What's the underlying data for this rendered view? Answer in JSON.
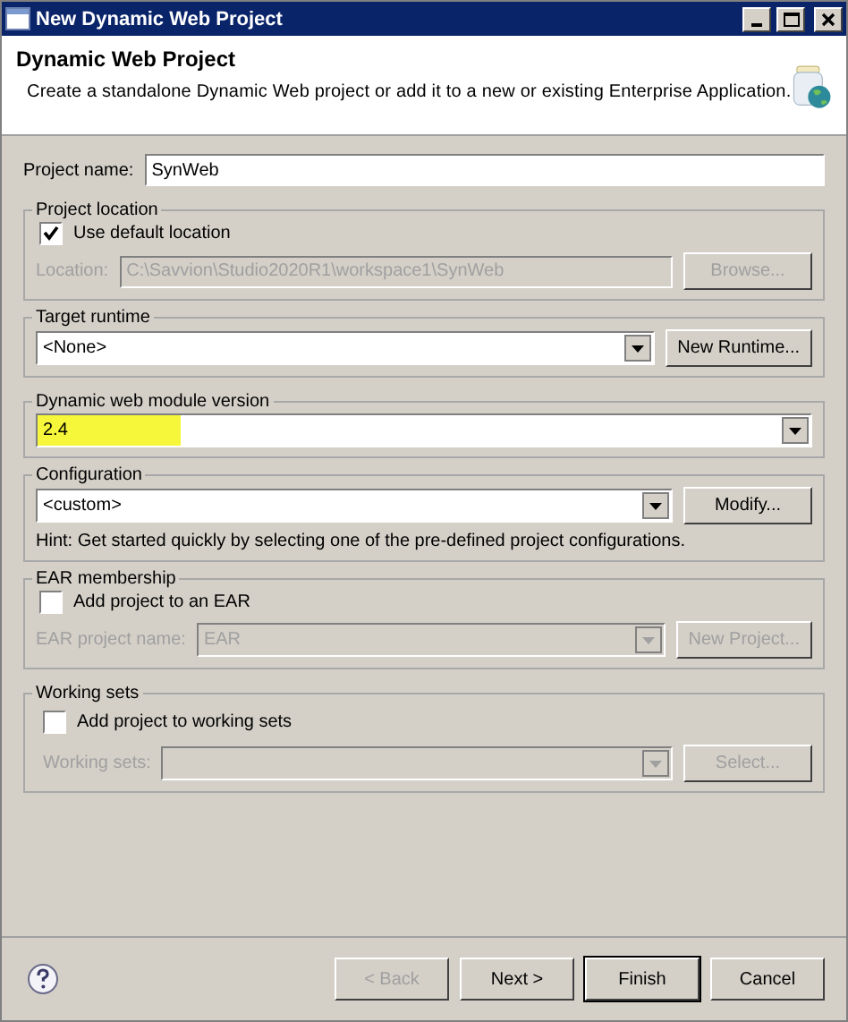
{
  "window": {
    "title": "New Dynamic Web Project"
  },
  "header": {
    "title": "Dynamic Web Project",
    "description": "Create a standalone Dynamic Web project or add it to a new or existing Enterprise Application."
  },
  "project_name": {
    "label": "Project name:",
    "value": "SynWeb"
  },
  "project_location": {
    "title": "Project location",
    "checkbox": {
      "label": "Use default location",
      "checked": true
    },
    "field": {
      "label": "Location:",
      "value": "C:\\Savvion\\Studio2020R1\\workspace1\\SynWeb",
      "disabled": true
    },
    "button": {
      "label": "Browse...",
      "disabled": true
    }
  },
  "target_runtime": {
    "title": "Target runtime",
    "dropdown": {
      "value": "<None>",
      "disabled": false
    },
    "button": {
      "label": "New Runtime...",
      "disabled": false
    }
  },
  "module_version": {
    "title": "Dynamic web module version",
    "dropdown": {
      "value": "2.4",
      "disabled": false,
      "highlighted": true
    }
  },
  "configuration": {
    "title": "Configuration",
    "dropdown": {
      "value": "<custom>",
      "disabled": false
    },
    "button": {
      "label": "Modify...",
      "disabled": false
    },
    "hint": "Hint: Get started quickly by selecting one of the pre-defined project configurations."
  },
  "ear_membership": {
    "title": "EAR membership",
    "checkbox": {
      "label": "Add project to an EAR",
      "checked": false
    },
    "dropdown": {
      "label": "EAR project name:",
      "value": "EAR",
      "disabled": true
    },
    "button": {
      "label": "New Project...",
      "disabled": true
    }
  },
  "working_sets": {
    "title": "Working sets",
    "checkbox": {
      "label": "Add project to working sets",
      "checked": false
    },
    "dropdown": {
      "label": "Working sets:",
      "disabled": true
    },
    "button": {
      "label": "Select...",
      "disabled": true
    }
  },
  "buttons": [
    {
      "label": "< Back",
      "disabled": true,
      "default": false
    },
    {
      "label": "Next >",
      "disabled": false,
      "default": false
    },
    {
      "label": "Finish",
      "disabled": false,
      "default": true
    },
    {
      "label": "Cancel",
      "disabled": false,
      "default": false
    }
  ]
}
